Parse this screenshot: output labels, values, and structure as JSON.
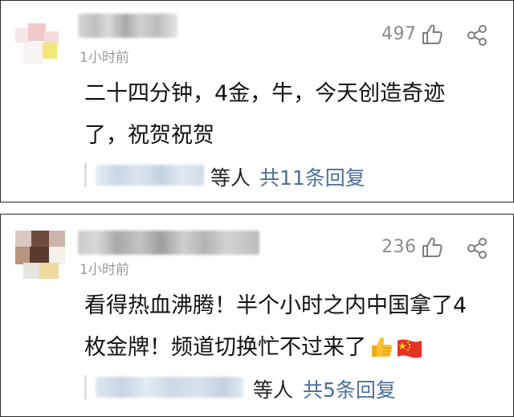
{
  "comments": [
    {
      "time": "1小时前",
      "likes": "497",
      "content": "二十四分钟，4金，牛，今天创造奇迹了，祝贺祝贺",
      "reply_by_suffix": "等人",
      "reply_link": "共11条回复"
    },
    {
      "time": "1小时前",
      "likes": "236",
      "content": "看得热血沸腾！半个小时之内中国拿了4枚金牌！频道切换忙不过来了",
      "emojis": [
        "thumbs-up-icon",
        "china-flag-icon"
      ],
      "reply_by_suffix": "等人",
      "reply_link": "共5条回复"
    }
  ],
  "colors": {
    "link": "#4a6f9c",
    "meta": "#9a9a9a",
    "text": "#111111"
  }
}
